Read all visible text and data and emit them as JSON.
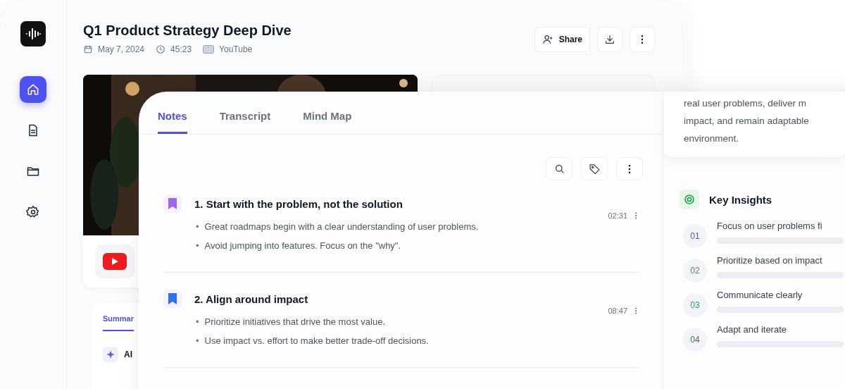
{
  "sidebar": {
    "items": [
      {
        "kind": "home",
        "selected": true
      },
      {
        "kind": "document",
        "selected": false
      },
      {
        "kind": "folder",
        "selected": false
      },
      {
        "kind": "settings",
        "selected": false
      }
    ]
  },
  "header": {
    "title": "Q1 Product Strategy Deep Dive",
    "meta": [
      {
        "kind": "date",
        "text": "May 7, 2024"
      },
      {
        "kind": "duration",
        "text": "45:23"
      },
      {
        "kind": "source",
        "text": "YouTube"
      }
    ],
    "share_button": "Share"
  },
  "summary_tabs": [
    {
      "label": "Summar",
      "selected": true
    }
  ],
  "ai_section": {
    "title": "AI"
  },
  "notes_panel": {
    "tabs": [
      {
        "label": "Notes",
        "selected": true
      },
      {
        "label": "Transcript",
        "selected": false
      },
      {
        "label": "Mind Map",
        "selected": false
      }
    ],
    "notes": [
      {
        "title": "1. Start with the problem, not the solution",
        "time": "02:31",
        "color": "#a066f0",
        "marker": "•",
        "bullets": [
          "Great roadmaps begin with a clear understanding of user problems.",
          "Avoid jumping into features. Focus on the \"why\"."
        ]
      },
      {
        "title": "2. Align around impact",
        "time": "08:47",
        "color": "#2f6ff0",
        "marker": "•",
        "bullets": [
          "Prioritize initiatives that drive the most value.",
          "Use impact vs. effort to make better trade-off decisions."
        ]
      }
    ]
  },
  "summary_card": {
    "lines": [
      "real user problems, deliver m",
      "impact, and remain adaptable",
      "environment."
    ]
  },
  "key_insights": {
    "title": "Key Insights",
    "items": [
      {
        "number": "01",
        "text": "Focus on user problems fi",
        "color": "#4f52d9"
      },
      {
        "number": "02",
        "text": "Prioritize based on impact",
        "color": "#6b7280"
      },
      {
        "number": "03",
        "text": "Communicate clearly",
        "color": "#2f9e5a"
      },
      {
        "number": "04",
        "text": "Adapt and iterate",
        "color": "#4b6b5a"
      }
    ]
  }
}
